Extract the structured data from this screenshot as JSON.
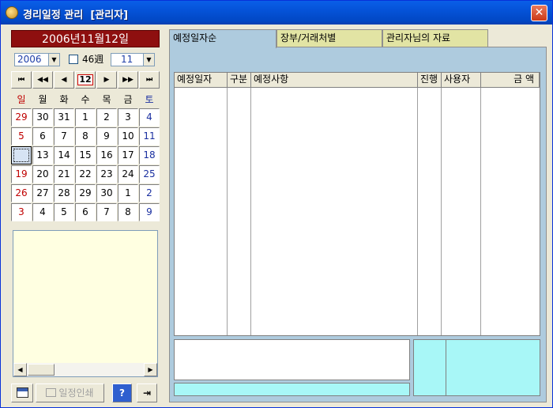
{
  "window": {
    "title": "경리일정 관리  [관리자]",
    "close_label": "✕"
  },
  "calendar": {
    "current_date": "2006년11월12일",
    "year": "2006",
    "week_label": "46週",
    "month": "11",
    "nav": [
      "⏮",
      "◀◀",
      "◀",
      "12",
      "▶",
      "▶▶",
      "⏭"
    ],
    "weekdays": [
      "일",
      "월",
      "화",
      "수",
      "목",
      "금",
      "토"
    ],
    "weeks": [
      [
        "29",
        "30",
        "31",
        "1",
        "2",
        "3",
        "4"
      ],
      [
        "5",
        "6",
        "7",
        "8",
        "9",
        "10",
        "11"
      ],
      [
        "",
        "13",
        "14",
        "15",
        "16",
        "17",
        "18"
      ],
      [
        "19",
        "20",
        "21",
        "22",
        "23",
        "24",
        "25"
      ],
      [
        "26",
        "27",
        "28",
        "29",
        "30",
        "1",
        "2"
      ],
      [
        "3",
        "4",
        "5",
        "6",
        "7",
        "8",
        "9"
      ]
    ]
  },
  "toolbar": {
    "print_label": "일정인쇄",
    "help_label": "?",
    "exit_label": "⇥"
  },
  "tabs": [
    "예정일자순",
    "장부/거래처별",
    "관리자님의 자료"
  ],
  "grid": {
    "columns": [
      "예정일자",
      "구분",
      "예정사항",
      "진행",
      "사용자",
      "금  액"
    ]
  },
  "colors": {
    "banner": "#8e0f0f",
    "tab_active": "#aecbde",
    "tab_inactive": "#e2e4a4",
    "memo": "#ffffe1",
    "cyan": "#a8f7f7",
    "sunday": "#c00000",
    "saturday": "#1a2fa0"
  }
}
